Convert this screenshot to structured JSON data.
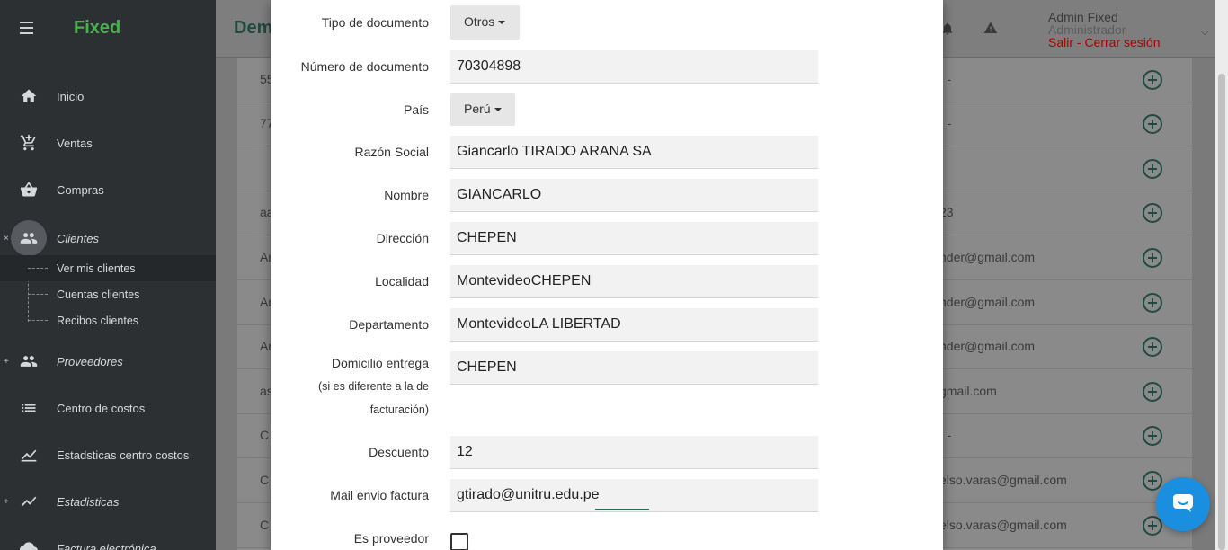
{
  "app": {
    "brand": "Fixed",
    "page_title": "Dem"
  },
  "sidebar": {
    "items": [
      {
        "label": "Inicio",
        "icon": "home-icon"
      },
      {
        "label": "Ventas",
        "icon": "cart-icon"
      },
      {
        "label": "Compras",
        "icon": "basket-icon"
      },
      {
        "label": "Clientes",
        "icon": "people-icon"
      },
      {
        "label": "Proveedores",
        "icon": "people-icon"
      },
      {
        "label": "Centro de costos",
        "icon": "list-icon"
      },
      {
        "label": "Estadsticas centro costos",
        "icon": "area-chart-icon"
      },
      {
        "label": "Estadisticas",
        "icon": "trending-icon"
      },
      {
        "label": "Factura electrónica",
        "icon": "cloud-icon"
      }
    ],
    "clientes_sub": [
      {
        "label": "Ver mis clientes"
      },
      {
        "label": "Cuentas clientes"
      },
      {
        "label": "Recibos clientes"
      }
    ]
  },
  "user": {
    "name": "Admin Fixed",
    "role": "Administrador",
    "logout": "Salir - Cerrar sesión"
  },
  "background_table": {
    "rows": [
      {
        "c1": "55",
        "c2": "- -"
      },
      {
        "c1": "77",
        "c2": "- -"
      },
      {
        "c1": "",
        "c2": ""
      },
      {
        "c1": "aa",
        "c2": "23"
      },
      {
        "c1": "Ar",
        "c2": "nder@gmail.com"
      },
      {
        "c1": "Ar",
        "c2": "nder@gmail.com"
      },
      {
        "c1": "Ar",
        "c2": "nder@gmail.com"
      },
      {
        "c1": "as",
        "c2": "gmail.com"
      },
      {
        "c1": "C",
        "c2": "- -"
      },
      {
        "c1": "C",
        "c2": "elso.varas@gmail.com"
      },
      {
        "c1": "C",
        "c2": "elso.varas@gmail.com"
      }
    ]
  },
  "form": {
    "tipo_documento": {
      "label": "Tipo de documento",
      "value": "Otros"
    },
    "numero_documento": {
      "label": "Número de documento",
      "value": "70304898"
    },
    "pais": {
      "label": "País",
      "value": "Perú"
    },
    "razon_social": {
      "label": "Razón Social",
      "value": "Giancarlo TIRADO ARANA SA"
    },
    "nombre": {
      "label": "Nombre",
      "value": "GIANCARLO"
    },
    "direccion": {
      "label": "Dirección",
      "value": "CHEPEN"
    },
    "localidad": {
      "label": "Localidad",
      "value": "MontevideoCHEPEN"
    },
    "departamento": {
      "label": "Departamento",
      "value": "MontevideoLA LIBERTAD"
    },
    "domicilio_entrega": {
      "label_line1": "Domicilio entrega",
      "label_line2": "(si es diferente a la de",
      "label_line3": "facturación)",
      "value": "CHEPEN"
    },
    "descuento": {
      "label": "Descuento",
      "value": "12"
    },
    "mail_envio": {
      "label": "Mail envio factura",
      "value": "gtirado@unitru.edu.pe"
    },
    "es_proveedor": {
      "label": "Es proveedor",
      "checked": false
    }
  },
  "colors": {
    "brand_green": "#4caf50",
    "logout_red": "#b00000",
    "chat_blue": "#1a8fe0",
    "focus_teal": "#1e6e5a"
  }
}
